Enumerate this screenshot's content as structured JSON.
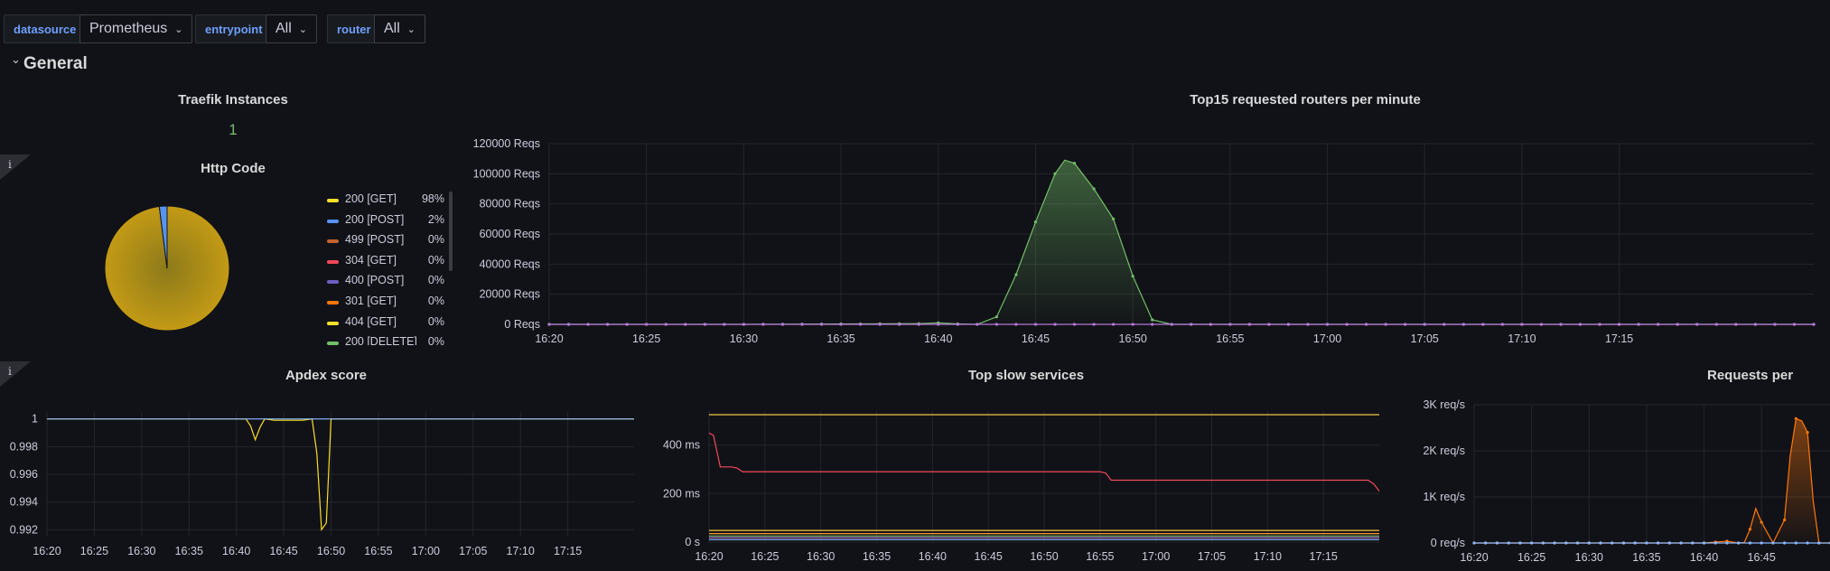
{
  "variables": [
    {
      "label": "datasource",
      "value": "Prometheus"
    },
    {
      "label": "entrypoint",
      "value": "All"
    },
    {
      "label": "router",
      "value": "All"
    }
  ],
  "row": {
    "title": "General"
  },
  "panels": {
    "instances": {
      "title": "Traefik Instances",
      "value": "1"
    },
    "http_code": {
      "title": "Http Code",
      "legend": [
        {
          "name": "200 [GET]",
          "pct": "98%",
          "color": "#fade2a"
        },
        {
          "name": "200 [POST]",
          "pct": "2%",
          "color": "#5794f2"
        },
        {
          "name": "499 [POST]",
          "pct": "0%",
          "color": "#c4622d"
        },
        {
          "name": "304 [GET]",
          "pct": "0%",
          "color": "#f2495c"
        },
        {
          "name": "400 [POST]",
          "pct": "0%",
          "color": "#6e5ec2"
        },
        {
          "name": "301 [GET]",
          "pct": "0%",
          "color": "#ff780a"
        },
        {
          "name": "404 [GET]",
          "pct": "0%",
          "color": "#fade2a"
        },
        {
          "name": "200 [DELETE]",
          "pct": "0%",
          "color": "#73bf69"
        }
      ]
    },
    "top_routers": {
      "title": "Top15 requested routers per minute"
    },
    "apdex": {
      "title": "Apdex score"
    },
    "slow_services": {
      "title": "Top slow services"
    },
    "requests": {
      "title": "Requests per"
    }
  },
  "chart_data": [
    {
      "id": "http-code-pie",
      "type": "pie",
      "title": "Http Code",
      "labels": [
        "200 [GET]",
        "200 [POST]",
        "499 [POST]",
        "304 [GET]",
        "400 [POST]",
        "301 [GET]",
        "404 [GET]",
        "200 [DELETE]"
      ],
      "values": [
        98,
        2,
        0,
        0,
        0,
        0,
        0,
        0
      ],
      "colors": [
        "#c39a15",
        "#5794f2",
        "#c4622d",
        "#f2495c",
        "#6e5ec2",
        "#ff780a",
        "#fade2a",
        "#73bf69"
      ]
    },
    {
      "id": "top-routers",
      "type": "area",
      "title": "Top15 requested routers per minute",
      "x_ticks": [
        "16:20",
        "16:25",
        "16:30",
        "16:35",
        "16:40",
        "16:45",
        "16:50",
        "16:55",
        "17:00",
        "17:05",
        "17:10",
        "17:15"
      ],
      "y_ticks": [
        "0 Reqs",
        "20000 Reqs",
        "40000 Reqs",
        "60000 Reqs",
        "80000 Reqs",
        "100000 Reqs",
        "120000 Reqs"
      ],
      "ylim": [
        0,
        120000
      ],
      "xlim_min": [
        0,
        65
      ],
      "series": [
        {
          "color": "#73bf69",
          "x": [
            0,
            10,
            19,
            20,
            21,
            22,
            23,
            24,
            25,
            26,
            26.5,
            27,
            28,
            29,
            30,
            31,
            32,
            65
          ],
          "y": [
            0,
            0,
            500,
            1000,
            300,
            0,
            5000,
            33000,
            68000,
            100000,
            109000,
            107000,
            90000,
            70000,
            32000,
            3000,
            0,
            0
          ]
        },
        {
          "color": "#b877d9",
          "x": [
            0,
            65
          ],
          "y": [
            0,
            0
          ]
        }
      ]
    },
    {
      "id": "apdex",
      "type": "line",
      "title": "Apdex score",
      "x_ticks": [
        "16:20",
        "16:25",
        "16:30",
        "16:35",
        "16:40",
        "16:45",
        "16:50",
        "16:55",
        "17:00",
        "17:05",
        "17:10",
        "17:15"
      ],
      "y_ticks": [
        "0.992",
        "0.994",
        "0.996",
        "0.998",
        "1"
      ],
      "ylim": [
        0.9915,
        1.0005
      ],
      "xlim_min": [
        0,
        62
      ],
      "series": [
        {
          "color": "#fade2a",
          "x": [
            0,
            21,
            21.5,
            22,
            22.5,
            23,
            24,
            25,
            26,
            27,
            28,
            28.5,
            29,
            29.5,
            30,
            62
          ],
          "y": [
            1,
            1,
            0.9995,
            0.9985,
            0.9994,
            1,
            0.9999,
            0.9999,
            0.9999,
            0.9999,
            1,
            0.9975,
            0.992,
            0.9925,
            1,
            1
          ]
        },
        {
          "color": "#8ab8ff",
          "x": [
            0,
            62
          ],
          "y": [
            1,
            1
          ]
        }
      ]
    },
    {
      "id": "slow-services",
      "type": "line",
      "title": "Top slow services",
      "x_ticks": [
        "16:20",
        "16:25",
        "16:30",
        "16:35",
        "16:40",
        "16:45",
        "16:50",
        "16:55",
        "17:00",
        "17:05",
        "17:10",
        "17:15"
      ],
      "y_ticks": [
        "0 s",
        "200 ms",
        "400 ms"
      ],
      "ylim": [
        0,
        540
      ],
      "xlim_min": [
        0,
        60
      ],
      "series": [
        {
          "color": "#f2c744",
          "x": [
            0,
            60
          ],
          "y": [
            525,
            525
          ]
        },
        {
          "color": "#f2495c",
          "x": [
            0,
            0.4,
            1,
            2,
            2.5,
            3,
            35,
            35.5,
            36,
            59,
            59.5,
            60
          ],
          "y": [
            450,
            440,
            310,
            310,
            305,
            290,
            290,
            285,
            255,
            255,
            240,
            210
          ]
        },
        {
          "color": "#f2c744",
          "x": [
            0,
            60
          ],
          "y": [
            48,
            48
          ]
        },
        {
          "color": "#ff9830",
          "x": [
            0,
            60
          ],
          "y": [
            35,
            35
          ]
        },
        {
          "color": "#73bf69",
          "x": [
            0,
            60
          ],
          "y": [
            25,
            25
          ]
        },
        {
          "color": "#b877d9",
          "x": [
            0,
            60
          ],
          "y": [
            18,
            18
          ]
        },
        {
          "color": "#8ab8ff",
          "x": [
            0,
            60
          ],
          "y": [
            10,
            10
          ]
        }
      ]
    },
    {
      "id": "requests",
      "type": "area",
      "title": "Requests per",
      "x_ticks": [
        "16:20",
        "16:25",
        "16:30",
        "16:35",
        "16:40",
        "16:45"
      ],
      "y_ticks": [
        "0 req/s",
        "1K req/s",
        "2K req/s",
        "3K req/s"
      ],
      "ylim": [
        0,
        3000
      ],
      "xlim_min": [
        0,
        33
      ],
      "series": [
        {
          "color": "#ff780a",
          "x": [
            0,
            20,
            22,
            23,
            23.5,
            24,
            24.5,
            25,
            26,
            27,
            27.5,
            28,
            28.5,
            29,
            29.5,
            30,
            31,
            33
          ],
          "y": [
            0,
            0,
            40,
            0,
            10,
            300,
            750,
            450,
            0,
            500,
            1900,
            2700,
            2650,
            2400,
            900,
            0,
            0,
            0
          ]
        },
        {
          "color": "#8ab8ff",
          "x": [
            0,
            33
          ],
          "y": [
            0,
            0
          ]
        }
      ]
    }
  ]
}
